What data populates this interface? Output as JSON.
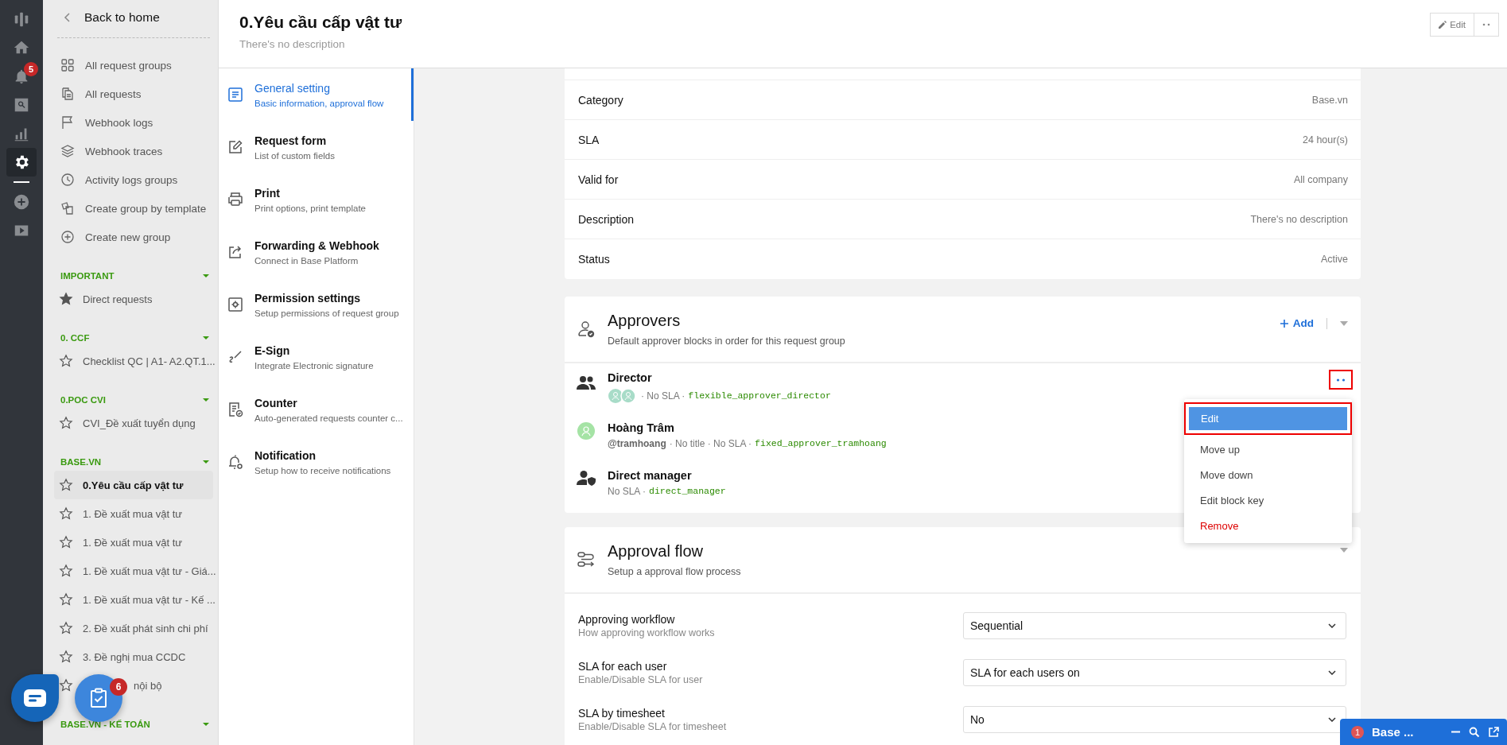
{
  "rail": [
    {
      "kind": "logo",
      "selected": false
    },
    {
      "kind": "home",
      "selected": false
    },
    {
      "kind": "bell",
      "selected": false,
      "badge": "5"
    },
    {
      "kind": "search",
      "selected": false
    },
    {
      "kind": "chart",
      "selected": false
    },
    {
      "kind": "settings",
      "selected": true
    },
    {
      "kind": "add",
      "selected": false
    },
    {
      "kind": "video",
      "selected": false
    }
  ],
  "sidebar": {
    "back_label": "Back to home",
    "links": [
      {
        "kind": "grid",
        "label": "All request groups"
      },
      {
        "kind": "copy",
        "label": "All requests"
      },
      {
        "kind": "flag",
        "label": "Webhook logs"
      },
      {
        "kind": "layers",
        "label": "Webhook traces"
      },
      {
        "kind": "clock",
        "label": "Activity logs groups"
      },
      {
        "kind": "template",
        "label": "Create group by template"
      },
      {
        "kind": "plus",
        "label": "Create new group"
      }
    ],
    "sections": [
      {
        "title": "IMPORTANT",
        "expanded": true,
        "items": [
          {
            "label": "Direct requests",
            "starred": true,
            "selected": false
          }
        ]
      },
      {
        "title": "0. CCF",
        "expanded": true,
        "items": [
          {
            "label": "Checklist QC | A1- A2.QT.1...",
            "starred": false,
            "selected": false
          }
        ]
      },
      {
        "title": "0.POC CVI",
        "expanded": true,
        "items": [
          {
            "label": "CVI_Đề xuất tuyển dụng",
            "starred": false,
            "selected": false
          }
        ]
      },
      {
        "title": "BASE.VN",
        "expanded": true,
        "items": [
          {
            "label": "0.Yêu cầu cấp vật tư",
            "starred": false,
            "selected": true
          },
          {
            "label": "1. Đề xuất mua vật tư",
            "starred": false,
            "selected": false
          },
          {
            "label": "1. Đề xuất mua vật tư",
            "starred": false,
            "selected": false
          },
          {
            "label": "1. Đề xuất mua vật tư - Giá...",
            "starred": false,
            "selected": false
          },
          {
            "label": "1. Đề xuất mua vật tư - Kế ...",
            "starred": false,
            "selected": false
          },
          {
            "label": "2. Đề xuất phát sinh chi phí",
            "starred": false,
            "selected": false
          },
          {
            "label": "3. Đề nghị mua CCDC",
            "starred": false,
            "selected": false
          },
          {
            "label": "nội bộ",
            "starred": false,
            "selected": false
          }
        ]
      },
      {
        "title": "BASE.VN - KẾ TOÁN",
        "expanded": true
      }
    ]
  },
  "header": {
    "title": "0.Yêu cầu cấp vật tư",
    "description": "There's no description",
    "edit_label": "Edit"
  },
  "nav": [
    {
      "kind": "document",
      "title": "General setting",
      "subtitle": "Basic information, approval flow",
      "selected": true
    },
    {
      "kind": "edit",
      "title": "Request form",
      "subtitle": "List of custom fields",
      "selected": false
    },
    {
      "kind": "print",
      "title": "Print",
      "subtitle": "Print options, print template",
      "selected": false
    },
    {
      "kind": "share",
      "title": "Forwarding & Webhook",
      "subtitle": "Connect in Base Platform",
      "selected": false
    },
    {
      "kind": "permission",
      "title": "Permission settings",
      "subtitle": "Setup permissions of request group",
      "selected": false
    },
    {
      "kind": "sign",
      "title": "E-Sign",
      "subtitle": "Integrate Electronic signature",
      "selected": false
    },
    {
      "kind": "counter",
      "title": "Counter",
      "subtitle": "Auto-generated requests counter c...",
      "selected": false
    },
    {
      "kind": "notification",
      "title": "Notification",
      "subtitle": "Setup how to receive notifications",
      "selected": false
    }
  ],
  "details": [
    {
      "label": "Category",
      "value": "Base.vn"
    },
    {
      "label": "SLA",
      "value": "24 hour(s)"
    },
    {
      "label": "Valid for",
      "value": "All company"
    },
    {
      "label": "Description",
      "value": "There's no description"
    },
    {
      "label": "Status",
      "value": "Active"
    }
  ],
  "approvers": {
    "title": "Approvers",
    "subtitle": "Default approver blocks in order for this request group",
    "add_label": "Add",
    "blocks": [
      {
        "kind": "group",
        "name": "Director",
        "info": "· No SLA ·",
        "key": "flexible_approver_director"
      },
      {
        "kind": "user",
        "name": "Hoàng Trâm",
        "handle": "@tramhoang",
        "info": "· No title · No SLA ·",
        "key": "fixed_approver_tramhoang"
      },
      {
        "kind": "manager",
        "name": "Direct manager",
        "info": "No SLA ·",
        "key": "direct_manager"
      }
    ],
    "menu": [
      {
        "label": "Edit",
        "kind": "normal",
        "selected": true
      },
      {
        "label": "Move up",
        "kind": "normal",
        "selected": false
      },
      {
        "label": "Move down",
        "kind": "normal",
        "selected": false
      },
      {
        "label": "Edit block key",
        "kind": "normal",
        "selected": false
      },
      {
        "label": "Remove",
        "kind": "danger",
        "selected": false
      }
    ]
  },
  "approval_flow": {
    "title": "Approval flow",
    "subtitle": "Setup a approval flow process",
    "settings": [
      {
        "label": "Approving workflow",
        "hint": "How approving workflow works",
        "value": "Sequential"
      },
      {
        "label": "SLA for each user",
        "hint": "Enable/Disable SLA for user",
        "value": "SLA for each users on"
      },
      {
        "label": "SLA by timesheet",
        "hint": "Enable/Disable SLA for timesheet",
        "value": "No"
      }
    ]
  },
  "task_badge": "6",
  "chat_bar": {
    "title": "Base ...",
    "count": "1"
  }
}
